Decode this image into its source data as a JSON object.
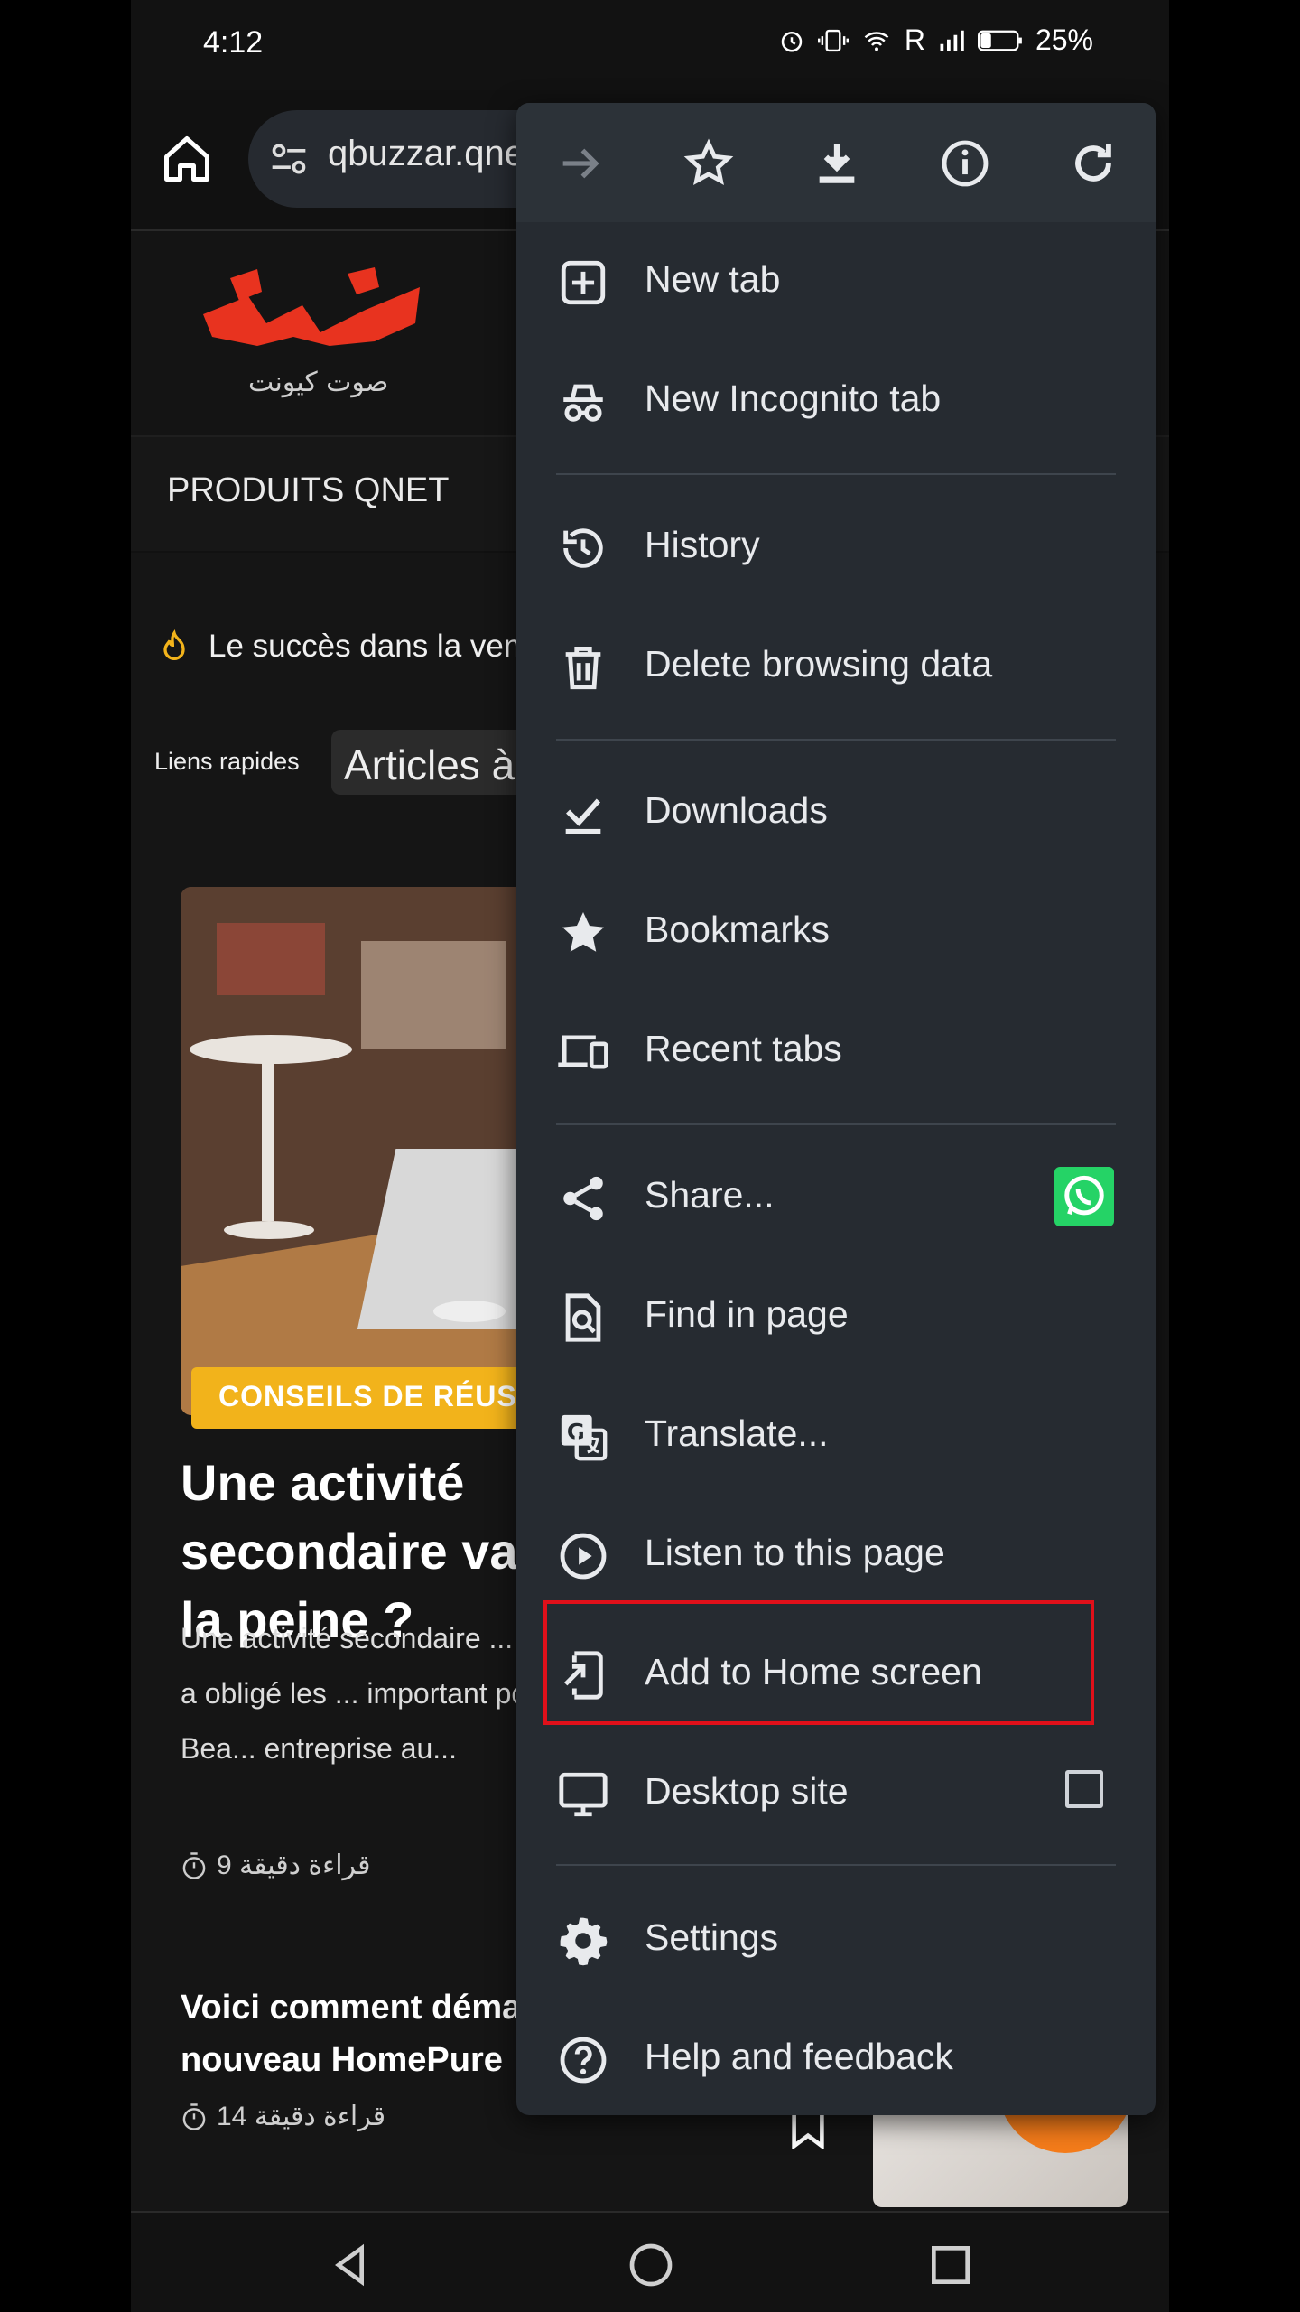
{
  "status_bar": {
    "time": "4:12",
    "carrier_r": "R",
    "battery": "25%"
  },
  "toolbar": {
    "url": "qbuzzar.qnet"
  },
  "site": {
    "logo_sub": "صوت كيونت",
    "nav_item": "PRODUITS QNET",
    "ticker": "Le succès dans la vente",
    "quick_links_label": "Liens rapides",
    "quick_link_pill": "Articles à",
    "category_badge": "CONSEILS DE RÉUSSITE",
    "article1_title": "Une activité secondaire vaut-elle la peine ?",
    "article1_excerpt": "Une activité secondaire ... pandémique a obligé les ... important pour eux. Bea... entreprise au...",
    "article1_read_time": "قراءة دقيقة 9",
    "article2_title": "Voici comment démarrer le nouveau HomePure",
    "article2_read_time": "قراءة دقيقة 14"
  },
  "menu": {
    "top_icons": [
      "forward-icon",
      "star-icon",
      "download-icon",
      "info-icon",
      "reload-icon"
    ],
    "items": {
      "new_tab": "New tab",
      "incognito": "New Incognito tab",
      "history": "History",
      "delete_data": "Delete browsing data",
      "downloads": "Downloads",
      "bookmarks": "Bookmarks",
      "recent_tabs": "Recent tabs",
      "share": "Share...",
      "find": "Find in page",
      "translate": "Translate...",
      "listen": "Listen to this page",
      "add_home": "Add to Home screen",
      "desktop": "Desktop site",
      "settings": "Settings",
      "help": "Help and feedback"
    },
    "desktop_site_checked": false,
    "highlight_color": "#e0101a"
  }
}
